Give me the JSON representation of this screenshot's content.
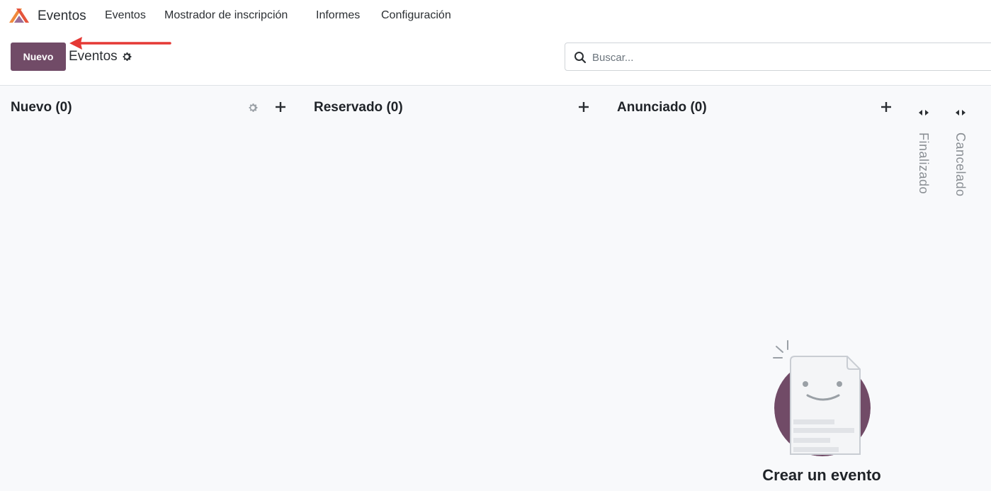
{
  "navbar": {
    "app_name": "Eventos",
    "logo_icon": "eventos-app-logo",
    "menu": [
      {
        "label": "Eventos"
      },
      {
        "label": "Mostrador de inscripción"
      },
      {
        "label": "Informes"
      },
      {
        "label": "Configuración"
      }
    ]
  },
  "control_panel": {
    "new_button": "Nuevo",
    "breadcrumb": "Eventos",
    "search_placeholder": "Buscar..."
  },
  "kanban": {
    "columns": [
      {
        "title": "Nuevo (0)"
      },
      {
        "title": "Reservado (0)"
      },
      {
        "title": "Anunciado (0)"
      }
    ],
    "folded_columns": [
      {
        "title": "Finalizado"
      },
      {
        "title": "Cancelado"
      }
    ]
  },
  "helper": {
    "title": "Crear un evento"
  },
  "colors": {
    "primary": "#714b67",
    "annotation_arrow": "#e53935",
    "logo_orange": "#f08a3c",
    "logo_red": "#e5543c",
    "logo_purple": "#8a5586"
  }
}
